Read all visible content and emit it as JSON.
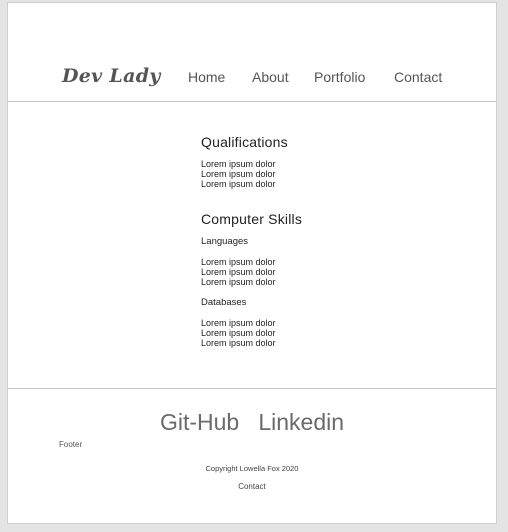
{
  "header": {
    "brand": "Dev Lady",
    "nav": [
      "Home",
      "About",
      "Portfolio",
      "Contact"
    ]
  },
  "main": {
    "qualifications": {
      "title": "Qualifications",
      "items": [
        "Lorem ipsum dolor",
        "Lorem ipsum dolor",
        "Lorem ipsum dolor"
      ]
    },
    "skills": {
      "title": "Computer Skills",
      "languages": {
        "label": "Languages",
        "items": [
          "Lorem ipsum dolor",
          "Lorem ipsum dolor",
          "Lorem ipsum dolor"
        ]
      },
      "databases": {
        "label": "Databases",
        "items": [
          "Lorem ipsum dolor",
          "Lorem ipsum dolor",
          "Lorem ipsum dolor"
        ]
      }
    }
  },
  "footer": {
    "links": [
      "Git-Hub",
      "Linkedin"
    ],
    "label": "Footer",
    "copyright": "Copyright Lowella Fox 2020",
    "contact": "Contact"
  }
}
